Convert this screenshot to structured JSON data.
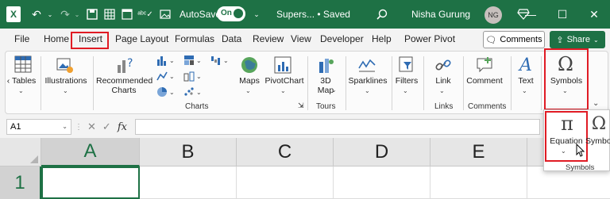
{
  "titlebar": {
    "autosave_label": "AutoSave",
    "autosave_state": "On",
    "doc_title": "Supers... • Saved",
    "user_name": "Nisha Gurung",
    "avatar_initials": "NG",
    "accent": "#1e7145"
  },
  "tabs": [
    "File",
    "Home",
    "Insert",
    "Page Layout",
    "Formulas",
    "Data",
    "Review",
    "View",
    "Developer",
    "Help",
    "Power Pivot"
  ],
  "active_tab": "Insert",
  "comments_label": "Comments",
  "share_label": "Share",
  "ribbon": {
    "tables": "Tables",
    "illustrations": "Illustrations",
    "recommended_charts_1": "Recommended",
    "recommended_charts_2": "Charts",
    "maps": "Maps",
    "pivotchart": "PivotChart",
    "map3d_1": "3D",
    "map3d_2": "Map",
    "sparklines": "Sparklines",
    "filters": "Filters",
    "link": "Link",
    "comment": "Comment",
    "text": "Text",
    "symbols": "Symbols",
    "group_charts": "Charts",
    "group_tours": "Tours",
    "group_links": "Links",
    "group_comments": "Comments"
  },
  "formula_bar": {
    "name_box": "A1",
    "fx": "fx"
  },
  "grid": {
    "columns": [
      "A",
      "B",
      "C",
      "D",
      "E"
    ],
    "rows": [
      "1"
    ],
    "selected_cell": "A1"
  },
  "flyout": {
    "equation_label": "Equation",
    "symbol_label": "Symbol",
    "group_label": "Symbols"
  }
}
